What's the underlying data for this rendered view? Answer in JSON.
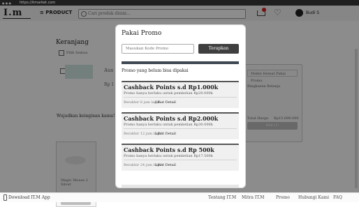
{
  "browser": {
    "url": "https://itmarket.com"
  },
  "header": {
    "logo": "I.m",
    "product_menu": "≡ PRODUCT",
    "search_placeholder": "Cari produk disini...",
    "user_name": "Budi S"
  },
  "background": {
    "cart_title": "Keranjang",
    "select_all": "Pilih Semua",
    "product_name_partial": "Aus",
    "price_partial": "Rp 1",
    "wishlist_label": "Wujudkan keinginan kamu!!",
    "wishlist_product": "Magic Mouse 2 Silver",
    "promo_placeholder_bg": "Makin Hemat Pakai Promo",
    "summary_title": "Ringkasan Belanja",
    "total_label": "Total Harga",
    "total_value": "Rp15.699.000",
    "buy_button": "Beli (1)"
  },
  "modal": {
    "title": "Pakai Promo",
    "input_placeholder": "Masukan Kode Promo",
    "apply_button": "Terapkan",
    "section_title": "Promo yang belum bisa dipakai",
    "promos": [
      {
        "title": "Cashback Points s.d Rp1.000k",
        "desc": "Promo hanya berlaku untuk pembelian Rp20.000k",
        "expire": "Berakhir 6 jam lagi!!",
        "detail": "Lihat Detail"
      },
      {
        "title": "Cashback Points s.d Rp2.000k",
        "desc": "Promo hanya berlaku untuk pembelian Rp30.000k",
        "expire": "Berakhir 12 jam lagi!!",
        "detail": "Lihat Detail"
      },
      {
        "title": "Cashback Points s.d Rp 500k",
        "desc": "Promo hanya berlaku untuk pembelian Rp17.500k",
        "expire": "Berakhir 24 jam lagi!!",
        "detail": "Lihat Detail"
      }
    ]
  },
  "footer": {
    "download": "Download IT.M App",
    "links": [
      "Tentang IT.M",
      "Mitra IT.M",
      "Promo",
      "Hubungi Kami",
      "FAQ"
    ]
  },
  "colors": {
    "overlay": "#00000073",
    "apply_button": "#3f3f3f",
    "cart_badge": "#d62020"
  }
}
